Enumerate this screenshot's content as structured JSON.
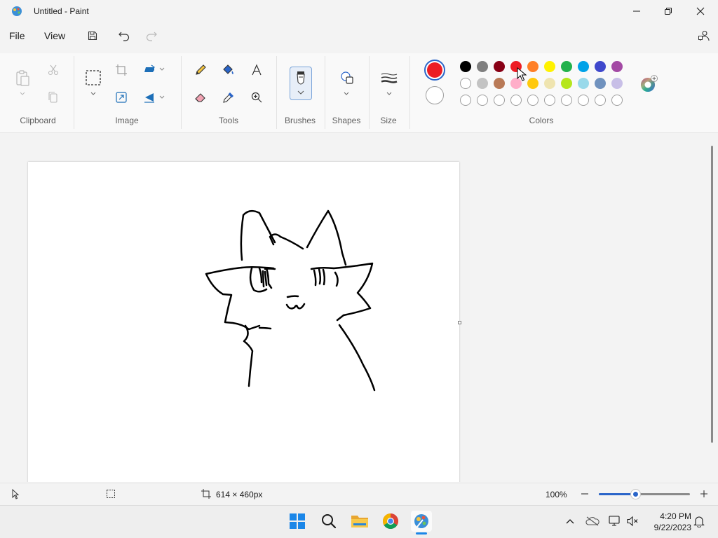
{
  "window": {
    "title": "Untitled - Paint"
  },
  "menu": {
    "file": "File",
    "view": "View"
  },
  "ribbon": {
    "groups": {
      "clipboard": "Clipboard",
      "image": "Image",
      "tools": "Tools",
      "brushes": "Brushes",
      "shapes": "Shapes",
      "size": "Size",
      "colors": "Colors"
    },
    "primary_color": "#ec1c24",
    "secondary_color": "#ffffff",
    "palette_row1": [
      "#000000",
      "#7f7f7f",
      "#880015",
      "#ed1c24",
      "#ff7f27",
      "#fff200",
      "#22b14c",
      "#00a2e8",
      "#3f48cc",
      "#a349a4"
    ],
    "palette_row2": [
      "#ffffff",
      "#c3c3c3",
      "#b97a57",
      "#ffaec9",
      "#ffc90e",
      "#efe4b0",
      "#b5e61d",
      "#99d9ea",
      "#7092be",
      "#c8bfe7"
    ],
    "palette_row3_empty_count": 10
  },
  "status": {
    "canvas_size": "614 × 460px",
    "zoom": "100%",
    "zoom_fraction": 0.4
  },
  "taskbar": {
    "time": "4:20 PM",
    "date": "9/22/2023"
  }
}
